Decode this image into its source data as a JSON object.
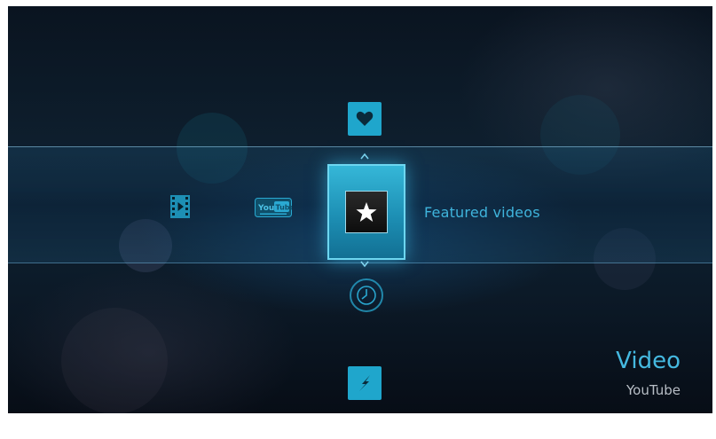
{
  "menu": {
    "selected_item_label": "Featured videos",
    "items": {
      "favorites_icon": "heart-icon",
      "featured_icon": "star-icon",
      "history_icon": "clock-icon",
      "trending_icon": "lightning-icon",
      "local_video_icon": "film-icon",
      "youtube_icon": "youtube-logo-icon"
    }
  },
  "section": {
    "title": "Video",
    "subtitle": "YouTube"
  },
  "colors": {
    "accent": "#1fa6cc",
    "label": "#3fb4dc",
    "subtitle": "#b8bec6"
  }
}
